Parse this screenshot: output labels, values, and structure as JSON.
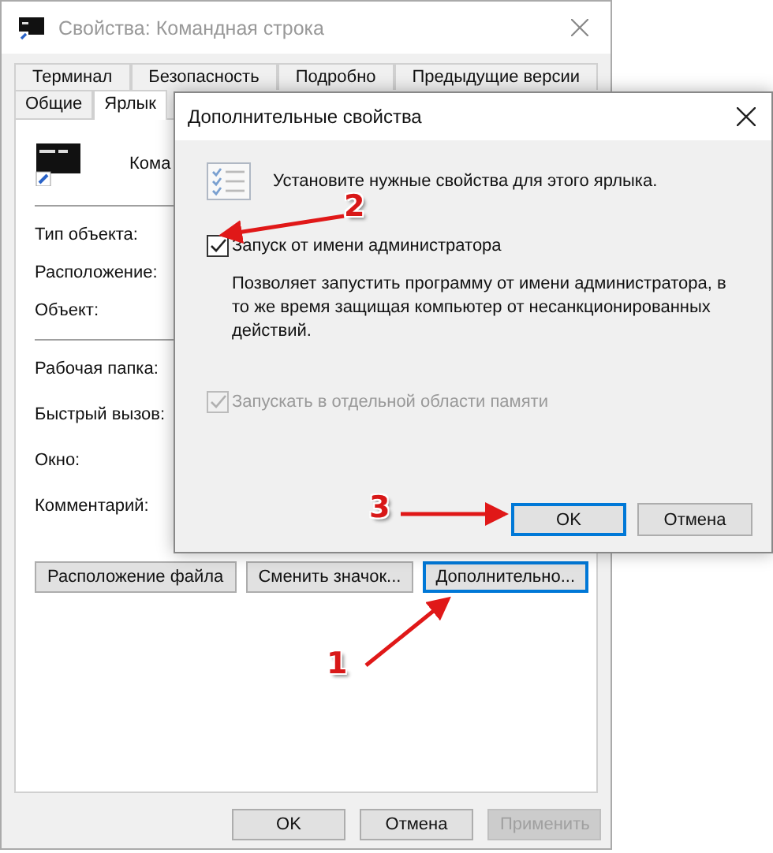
{
  "window": {
    "title": "Свойства: Командная строка",
    "tab_rows": [
      [
        {
          "label": "Терминал",
          "selected": false
        },
        {
          "label": "Безопасность",
          "selected": false
        },
        {
          "label": "Подробно",
          "selected": false
        },
        {
          "label": "Предыдущие версии",
          "selected": false
        }
      ],
      [
        {
          "label": "Общие",
          "selected": false
        },
        {
          "label": "Ярлык",
          "selected": true
        }
      ]
    ],
    "shortcut_name": "Кома",
    "field_groups": [
      [
        "Тип объекта:",
        "Расположение:",
        "Объект:"
      ],
      [
        "Рабочая папка:",
        "Быстрый вызов:",
        "Окно:",
        "Комментарий:"
      ]
    ],
    "buttons": [
      {
        "label": "Расположение файла",
        "focused": false
      },
      {
        "label": "Сменить значок...",
        "focused": false
      },
      {
        "label": "Дополнительно...",
        "focused": true
      }
    ],
    "footer": [
      {
        "label": "OK",
        "disabled": false
      },
      {
        "label": "Отмена",
        "disabled": false
      },
      {
        "label": "Применить",
        "disabled": true
      }
    ]
  },
  "dialog": {
    "title": "Дополнительные свойства",
    "intro": "Установите нужные свойства для этого ярлыка.",
    "options": [
      {
        "label": "Запуск от имени администратора",
        "checked": true,
        "disabled": false,
        "description": "Позволяет запустить программу от имени администратора, в то же время защищая компьютер от несанкционированных действий."
      },
      {
        "label": "Запускать в отдельной области памяти",
        "checked": true,
        "disabled": true
      }
    ],
    "buttons": [
      {
        "label": "OK",
        "focused": true
      },
      {
        "label": "Отмена",
        "focused": false
      }
    ]
  },
  "annotations": [
    {
      "number": "1"
    },
    {
      "number": "2"
    },
    {
      "number": "3"
    }
  ]
}
